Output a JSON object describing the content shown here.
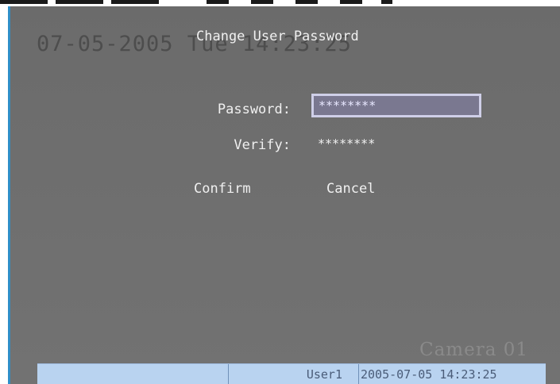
{
  "osd": {
    "datetime": "07-05-2005 Tue 14:23:25",
    "camera": "Camera 01"
  },
  "dialog": {
    "title": "Change User Password",
    "password_label": "Password:",
    "password_value": "********",
    "verify_label": "Verify:",
    "verify_value": "********",
    "confirm_label": "Confirm",
    "cancel_label": "Cancel"
  },
  "status_bar": {
    "cells": [
      "",
      "User1",
      "2005-07-05 14:23:25"
    ]
  },
  "colors": {
    "background": "#6e6e6e",
    "text": "#f0f0f0",
    "input_border": "#cfcfe8",
    "status_bar": "#b9d3f0"
  }
}
